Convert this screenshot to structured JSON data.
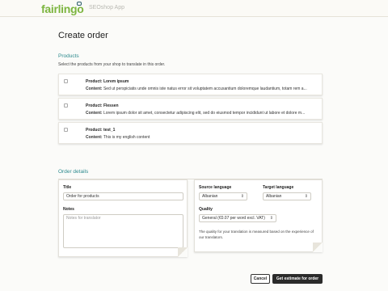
{
  "header": {
    "logo": "fairlingo",
    "app_name": "SEOshop App"
  },
  "page": {
    "title": "Create order"
  },
  "products": {
    "section_title": "Products",
    "description": "Select the products from your shop to translate in this order.",
    "content_prefix": "Content:",
    "items": [
      {
        "name": "Product: Lorem ipsum",
        "content": "Sed ut perspiciatis unde omnis iste natus error sit voluptatem accusantium doloremque laudantium, totam rem a..."
      },
      {
        "name": "Product: Flessen",
        "content": "Lorem ipsum dolor sit amet, consectetur adipiscing elit, sed do eiusmod tempor incididunt ut labore et dolore m..."
      },
      {
        "name": "Product: test_1",
        "content": "This is my english content"
      }
    ]
  },
  "order_details": {
    "section_title": "Order details",
    "title_label": "Title",
    "title_value": "Order for products",
    "notes_label": "Notes",
    "notes_placeholder": "Notes for translator",
    "source_label": "Source language",
    "source_value": "Albanian",
    "target_label": "Target language",
    "target_value": "Albanian",
    "quality_label": "Quality",
    "quality_value": "General (€0.07 per word excl. VAT)",
    "help_text": "The quality for your translation is measured based on the experience of our translators."
  },
  "actions": {
    "cancel": "Cancel",
    "estimate": "Get estimate for order"
  },
  "colors": {
    "brand_green": "#7cb53f",
    "section_teal": "#2d8a8e",
    "button_dark": "#2b2b2b"
  }
}
